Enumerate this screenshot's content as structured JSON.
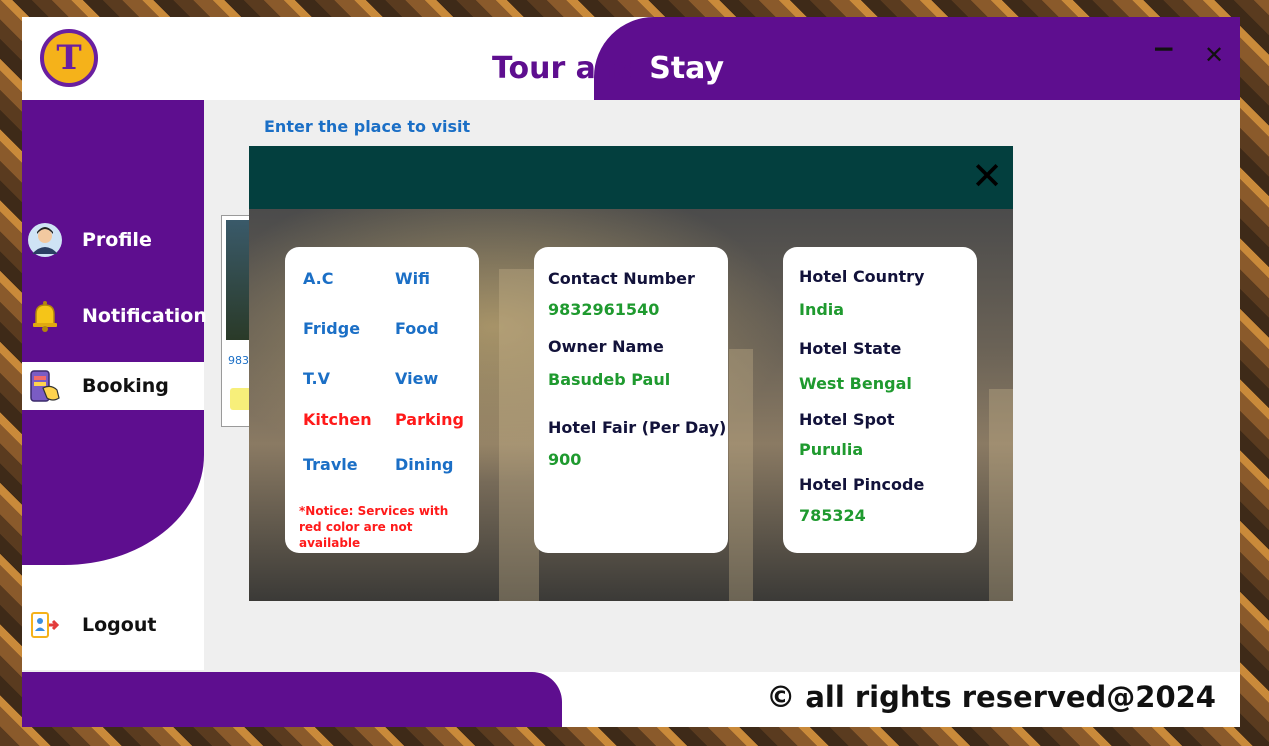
{
  "app": {
    "title_part1": "Tour and",
    "title_part2": "Stay",
    "logo_letter": "T",
    "minimize": "−",
    "close": "✕"
  },
  "sidebar": {
    "items": [
      {
        "label": "Profile",
        "icon": "user-avatar-icon"
      },
      {
        "label": "Notification",
        "icon": "bell-icon"
      },
      {
        "label": "Booking",
        "icon": "booking-hand-icon",
        "active": true
      },
      {
        "label": "Logout",
        "icon": "logout-icon"
      }
    ]
  },
  "content": {
    "title": "Enter the place to visit",
    "card_text": "983"
  },
  "modal": {
    "close": "✕",
    "amenities": {
      "ac": "A.C",
      "wifi": "Wifi",
      "fridge": "Fridge",
      "food": "Food",
      "tv": "T.V",
      "view": "View",
      "kitchen": "Kitchen",
      "parking": "Parking",
      "travle": "Travle",
      "dining": "Dining",
      "notice": "*Notice: Services with red color are not available"
    },
    "contact": {
      "contact_label": "Contact Number",
      "contact_value": "9832961540",
      "owner_label": "Owner Name",
      "owner_value": "Basudeb Paul",
      "fair_label": "Hotel Fair (Per Day)",
      "fair_value": "900"
    },
    "location": {
      "country_label": "Hotel Country",
      "country_value": "India",
      "state_label": "Hotel State",
      "state_value": "West Bengal",
      "spot_label": "Hotel Spot",
      "spot_value": "Purulia",
      "pincode_label": "Hotel Pincode",
      "pincode_value": "785324"
    }
  },
  "footer": {
    "text": "© all rights reserved@2024"
  },
  "colors": {
    "purple": "#5e0e8f",
    "modal_header": "#033f3e",
    "available": "#1b6fc6",
    "unavailable": "#ff1a1a",
    "value_green": "#1f9a2f"
  }
}
